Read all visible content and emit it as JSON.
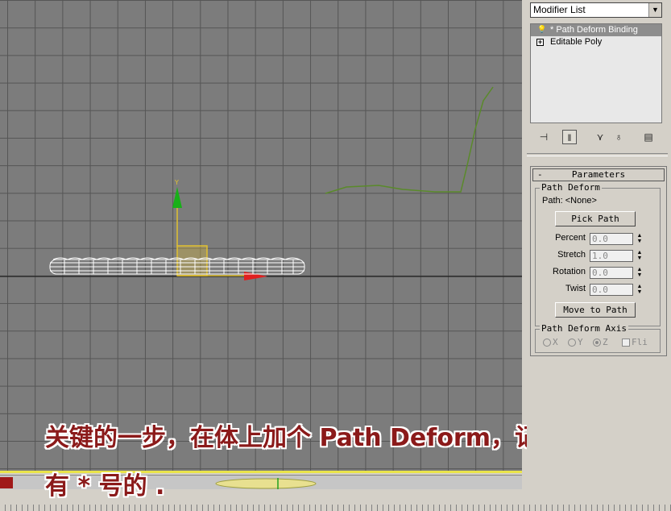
{
  "viewport": {
    "axis_y_label": "Y"
  },
  "caption": {
    "line1": "关键的一步，在体上加个 Path Deform，记住是前面",
    "line2": "有 * 号的 ."
  },
  "modifier_list": {
    "label": "Modifier List"
  },
  "stack": {
    "items": [
      {
        "label": "* Path Deform Binding",
        "icon": "lightbulb-icon",
        "selected": true
      },
      {
        "label": "Editable Poly",
        "icon": "plus-expand-icon",
        "selected": false
      }
    ]
  },
  "stack_toolbar": {
    "icons": [
      "pin-stack-icon",
      "show-end-result-icon",
      "make-unique-icon",
      "remove-modifier-icon",
      "configure-modifier-sets-icon"
    ]
  },
  "parameters": {
    "rollout_title": "Parameters",
    "rollout_toggle": "-",
    "group_title": "Path Deform",
    "path_label": "Path: <None>",
    "pick_path": "Pick Path",
    "fields": [
      {
        "label": "Percent",
        "value": "0.0"
      },
      {
        "label": "Stretch",
        "value": "1.0"
      },
      {
        "label": "Rotation",
        "value": "0.0"
      },
      {
        "label": "Twist",
        "value": "0.0"
      }
    ],
    "move_to_path": "Move to Path",
    "axis_group_title": "Path Deform Axis",
    "axis_options": {
      "x": "X",
      "y": "Y",
      "z": "Z",
      "flip": "Fli"
    },
    "axis_selected": "Z"
  }
}
